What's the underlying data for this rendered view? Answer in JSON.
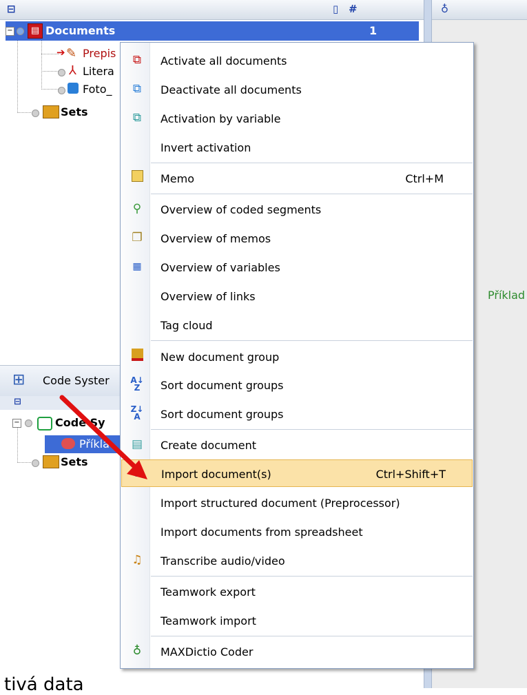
{
  "doc_tree": {
    "root_label": "Documents",
    "root_count": "1",
    "items": [
      "Prepis",
      "Litera",
      "Foto_"
    ],
    "sets_label": "Sets"
  },
  "code_system": {
    "header_label": "Code Syster",
    "root_label": "Code Sy",
    "selected_label": "Příkla",
    "sets_label": "Sets"
  },
  "right_pane": {
    "text": "Příklad"
  },
  "menu": {
    "items": [
      {
        "label": "Activate all documents",
        "shortcut": "",
        "icon": "activate-docs-icon"
      },
      {
        "label": "Deactivate all documents",
        "shortcut": "",
        "icon": "deactivate-docs-icon"
      },
      {
        "label": "Activation by variable",
        "shortcut": "",
        "icon": "activation-variable-icon"
      },
      {
        "label": "Invert activation",
        "shortcut": "",
        "icon": ""
      },
      {
        "label": "Memo",
        "shortcut": "Ctrl+M",
        "icon": "memo-icon"
      },
      {
        "label": "Overview of coded segments",
        "shortcut": "",
        "icon": "coded-segments-icon"
      },
      {
        "label": "Overview of memos",
        "shortcut": "",
        "icon": "memos-overview-icon"
      },
      {
        "label": "Overview of variables",
        "shortcut": "",
        "icon": "variables-grid-icon"
      },
      {
        "label": "Overview of links",
        "shortcut": "",
        "icon": ""
      },
      {
        "label": "Tag cloud",
        "shortcut": "",
        "icon": ""
      },
      {
        "label": "New document group",
        "shortcut": "",
        "icon": "new-group-icon"
      },
      {
        "label": "Sort document groups",
        "shortcut": "",
        "icon": "sort-az-icon"
      },
      {
        "label": "Sort document groups",
        "shortcut": "",
        "icon": "sort-za-icon"
      },
      {
        "label": "Create document",
        "shortcut": "",
        "icon": "create-document-icon"
      },
      {
        "label": "Import document(s)",
        "shortcut": "Ctrl+Shift+T",
        "icon": "import-document-icon"
      },
      {
        "label": "Import structured document (Preprocessor)",
        "shortcut": "",
        "icon": ""
      },
      {
        "label": "Import documents from spreadsheet",
        "shortcut": "",
        "icon": ""
      },
      {
        "label": "Transcribe audio/video",
        "shortcut": "",
        "icon": "transcribe-icon"
      },
      {
        "label": "Teamwork export",
        "shortcut": "",
        "icon": ""
      },
      {
        "label": "Teamwork import",
        "shortcut": "",
        "icon": ""
      },
      {
        "label": "MAXDictio Coder",
        "shortcut": "",
        "icon": "maxdictio-icon"
      }
    ]
  },
  "bottom_text": "tivá data",
  "colors": {
    "selection": "#3d6bd6",
    "menu_highlight": "#fbe2a8",
    "arrow": "#e01010"
  }
}
